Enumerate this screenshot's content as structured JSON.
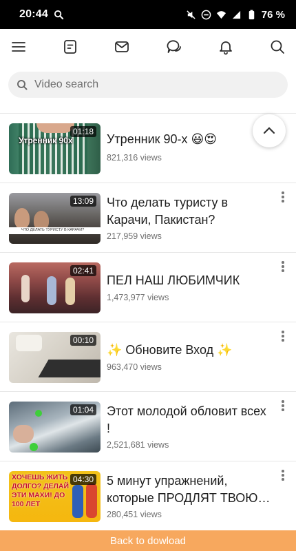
{
  "status_bar": {
    "time": "20:44",
    "battery": "76 %"
  },
  "nav": {
    "icons": [
      "menu-icon",
      "notes-icon",
      "mail-icon",
      "chat-icon",
      "bell-icon",
      "search-icon"
    ]
  },
  "search": {
    "placeholder": "Video search"
  },
  "videos": [
    {
      "title": "Утренник 90-х 😃😍",
      "views": "821,316 views",
      "duration": "01:18",
      "thumb_text": "Утренник 90х"
    },
    {
      "title": "Что делать туристу в Карачи, Пакистан?",
      "views": "217,959 views",
      "duration": "13:09",
      "thumb_text": "ЧТО ДЕЛАТЬ ТУРИСТУ В КАРАЧИ?"
    },
    {
      "title": "ПЕЛ НАШ ЛЮБИМЧИК",
      "views": "1,473,977 views",
      "duration": "02:41"
    },
    {
      "title": "✨ Обновите Вход ✨",
      "views": "963,470 views",
      "duration": "00:10"
    },
    {
      "title": "Этот молодой обловит всех !",
      "views": "2,521,681 views",
      "duration": "01:04"
    },
    {
      "title": "5 минут упражнений, которые ПРОДЛЯТ ТВОЮ…",
      "views": "280,451 views",
      "duration": "04:30",
      "thumb_text": "ХОЧЕШЬ ЖИТЬ ДОЛГО? ДЕЛАЙ ЭТИ МАХИ! ДО 100 ЛЕТ"
    }
  ],
  "bottom_button": {
    "label": "Back to dowload"
  },
  "colors": {
    "accent": "#f7a85e",
    "status_bar": "#000000"
  }
}
